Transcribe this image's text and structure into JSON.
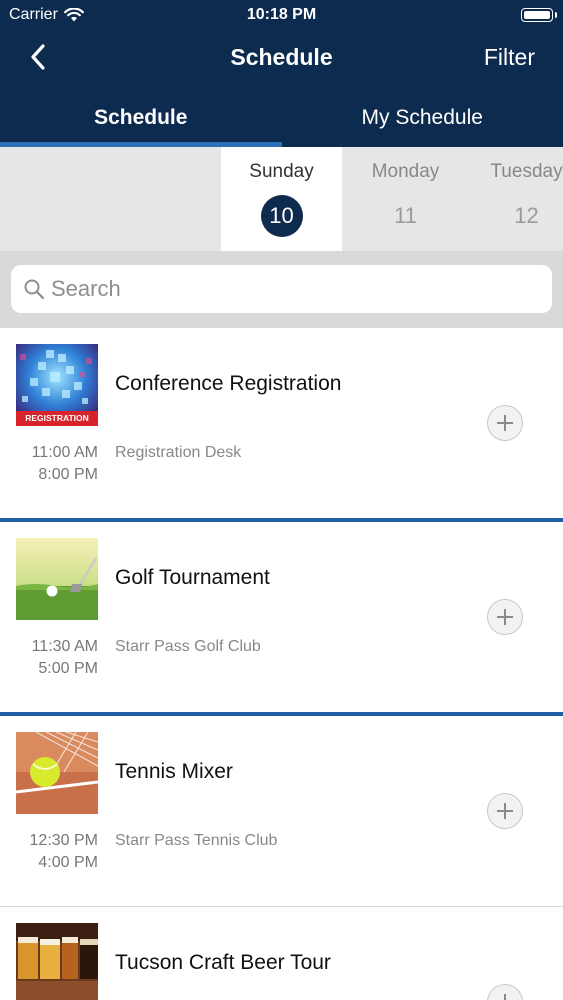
{
  "status_bar": {
    "carrier": "Carrier",
    "time": "10:18 PM"
  },
  "nav": {
    "title": "Schedule",
    "filter_label": "Filter",
    "back_icon": "chevron-left-icon"
  },
  "tabs": [
    {
      "label": "Schedule",
      "active": true
    },
    {
      "label": "My Schedule",
      "active": false
    }
  ],
  "days": [
    {
      "name": "Sunday",
      "number": "10",
      "selected": true
    },
    {
      "name": "Monday",
      "number": "11",
      "selected": false
    },
    {
      "name": "Tuesday",
      "number": "12",
      "selected": false
    }
  ],
  "search": {
    "placeholder": "Search",
    "value": ""
  },
  "events": [
    {
      "title": "Conference Registration",
      "start": "11:00 AM",
      "end": "8:00 PM",
      "location": "Registration Desk",
      "thumb_label": "REGISTRATION"
    },
    {
      "title": "Golf Tournament",
      "start": "11:30 AM",
      "end": "5:00 PM",
      "location": "Starr Pass Golf Club"
    },
    {
      "title": "Tennis Mixer",
      "start": "12:30 PM",
      "end": "4:00 PM",
      "location": "Starr Pass Tennis Club"
    },
    {
      "title": "Tucson Craft Beer Tour",
      "start": "",
      "end": "",
      "location": ""
    }
  ],
  "colors": {
    "header_bg": "#0d2a4f",
    "accent": "#1f5fa8",
    "selected_day": "#0d2a4f"
  }
}
